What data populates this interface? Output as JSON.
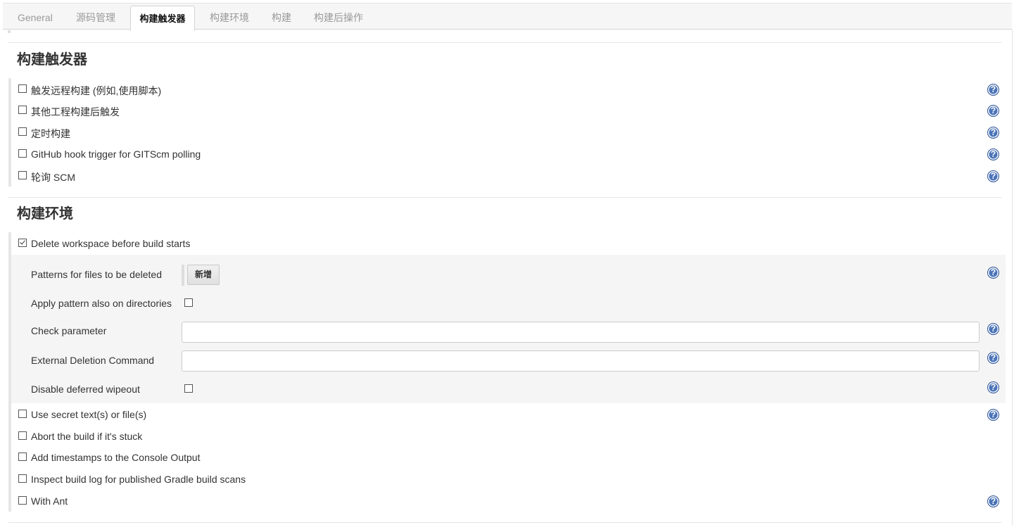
{
  "tabs": [
    {
      "label": "General"
    },
    {
      "label": "源码管理"
    },
    {
      "label": "构建触发器"
    },
    {
      "label": "构建环境"
    },
    {
      "label": "构建"
    },
    {
      "label": "构建后操作"
    }
  ],
  "active_tab": "构建触发器",
  "triggers": {
    "title": "构建触发器",
    "items": [
      {
        "label": "触发远程构建 (例如,使用脚本)",
        "checked": false
      },
      {
        "label": "其他工程构建后触发",
        "checked": false
      },
      {
        "label": "定时构建",
        "checked": false
      },
      {
        "label": "GitHub hook trigger for GITScm polling",
        "checked": false
      },
      {
        "label": "轮询 SCM",
        "checked": false
      }
    ]
  },
  "environment": {
    "title": "构建环境",
    "delete_workspace": {
      "label": "Delete workspace before build starts",
      "checked": true
    },
    "sub": {
      "patterns_label": "Patterns for files to be deleted",
      "add_button": "新增",
      "apply_pattern_label": "Apply pattern also on directories",
      "apply_pattern_checked": false,
      "check_parameter_label": "Check parameter",
      "check_parameter_value": "",
      "external_command_label": "External Deletion Command",
      "external_command_value": "",
      "disable_wipeout_label": "Disable deferred wipeout",
      "disable_wipeout_checked": false
    },
    "items": [
      {
        "label": "Use secret text(s) or file(s)",
        "checked": false
      },
      {
        "label": "Abort the build if it's stuck",
        "checked": false
      },
      {
        "label": "Add timestamps to the Console Output",
        "checked": false
      },
      {
        "label": "Inspect build log for published Gradle build scans",
        "checked": false
      },
      {
        "label": "With Ant",
        "checked": false
      }
    ]
  },
  "help_icon_glyph": "?",
  "colors": {
    "help_icon": "#4a73b8",
    "subpanel_bg": "#f5f5f5",
    "tabbar_bg": "#f6f6f6"
  }
}
